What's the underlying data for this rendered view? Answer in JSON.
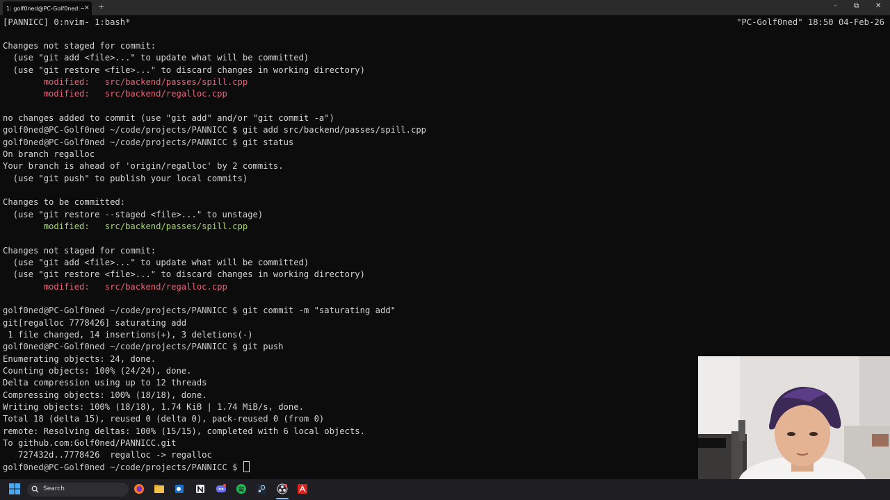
{
  "window": {
    "tab_title": "1: golf0ned@PC-Golf0ned:~",
    "new_tab": "+",
    "minimize": "–",
    "restore": "⧉",
    "close": "✕"
  },
  "tmux": {
    "left": "[PANNICC] 0:nvim- 1:bash*",
    "right": "\"PC-Golf0ned\" 18:50 04-Feb-26"
  },
  "terminal": {
    "prompt": "golf0ned@PC-Golf0ned ~/code/projects/PANNICC $",
    "lines": [
      {
        "text": "Changes not staged for commit:"
      },
      {
        "text": "  (use \"git add <file>...\" to update what will be committed)"
      },
      {
        "text": "  (use \"git restore <file>...\" to discard changes in working directory)"
      },
      {
        "text": "        modified:   src/backend/passes/spill.cpp",
        "color": "red"
      },
      {
        "text": "        modified:   src/backend/regalloc.cpp",
        "color": "red"
      },
      {
        "text": ""
      },
      {
        "text": "no changes added to commit (use \"git add\" and/or \"git commit -a\")"
      },
      {
        "cmd": "git add src/backend/passes/spill.cpp"
      },
      {
        "cmd": "git status"
      },
      {
        "text": "On branch regalloc"
      },
      {
        "text": "Your branch is ahead of 'origin/regalloc' by 2 commits."
      },
      {
        "text": "  (use \"git push\" to publish your local commits)"
      },
      {
        "text": ""
      },
      {
        "text": "Changes to be committed:"
      },
      {
        "text": "  (use \"git restore --staged <file>...\" to unstage)"
      },
      {
        "text": "        modified:   src/backend/passes/spill.cpp",
        "color": "green"
      },
      {
        "text": ""
      },
      {
        "text": "Changes not staged for commit:"
      },
      {
        "text": "  (use \"git add <file>...\" to update what will be committed)"
      },
      {
        "text": "  (use \"git restore <file>...\" to discard changes in working directory)"
      },
      {
        "text": "        modified:   src/backend/regalloc.cpp",
        "color": "red"
      },
      {
        "text": ""
      },
      {
        "cmd": "git commit -m \"saturating add\""
      },
      {
        "text": "git[regalloc 7778426] saturating add"
      },
      {
        "text": " 1 file changed, 14 insertions(+), 3 deletions(-)"
      },
      {
        "cmd": "git push"
      },
      {
        "text": "Enumerating objects: 24, done."
      },
      {
        "text": "Counting objects: 100% (24/24), done."
      },
      {
        "text": "Delta compression using up to 12 threads"
      },
      {
        "text": "Compressing objects: 100% (18/18), done."
      },
      {
        "text": "Writing objects: 100% (18/18), 1.74 KiB | 1.74 MiB/s, done."
      },
      {
        "text": "Total 18 (delta 15), reused 0 (delta 0), pack-reused 0 (from 0)"
      },
      {
        "text": "remote: Resolving deltas: 100% (15/15), completed with 6 local objects."
      },
      {
        "text": "To github.com:Golf0ned/PANNICC.git"
      },
      {
        "text": "   727432d..7778426  regalloc -> regalloc"
      },
      {
        "cmd": "",
        "cursor": true
      }
    ]
  },
  "taskbar": {
    "search_label": "Search",
    "icons": [
      "windows-start-icon",
      "firefox-icon",
      "file-explorer-icon",
      "outlook-icon",
      "notion-icon",
      "discord-icon",
      "spotify-icon",
      "steam-icon",
      "obs-icon",
      "acrobat-icon"
    ]
  },
  "colors": {
    "modified_unstaged": "#e8647a",
    "modified_staged": "#a6d96a",
    "terminal_bg": "#0c0c0c",
    "taskbar_bg": "#1f1f23"
  }
}
